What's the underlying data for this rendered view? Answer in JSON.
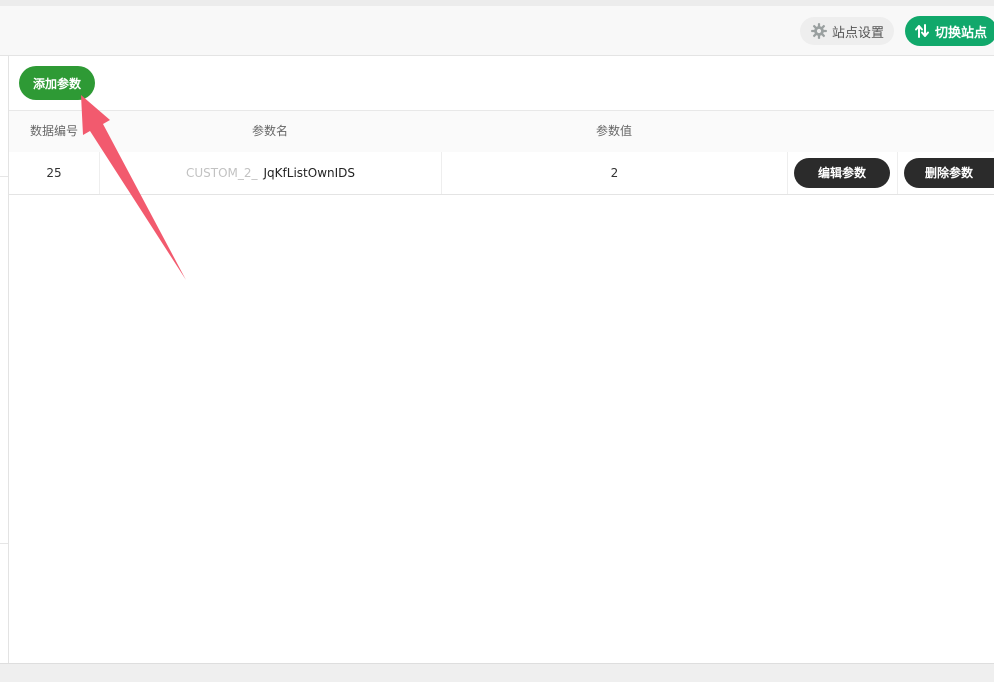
{
  "header": {
    "settings_label": "站点设置",
    "settings_icon": "gear-icon",
    "switch_label": "切换站点",
    "switch_icon": "switch-arrows-icon",
    "switch_color": "#11a86b"
  },
  "toolbar": {
    "add_label": "添加参数",
    "add_color": "#2e9a35"
  },
  "table": {
    "columns": [
      "数据编号",
      "参数名",
      "参数值"
    ],
    "rows": [
      {
        "id": "25",
        "name_prefix": "CUSTOM_2_",
        "name": "JqKfListOwnIDS",
        "value": "2",
        "edit_label": "编辑参数",
        "delete_label": "删除参数"
      }
    ]
  },
  "annotation": {
    "arrow_color": "#f25a6e"
  }
}
